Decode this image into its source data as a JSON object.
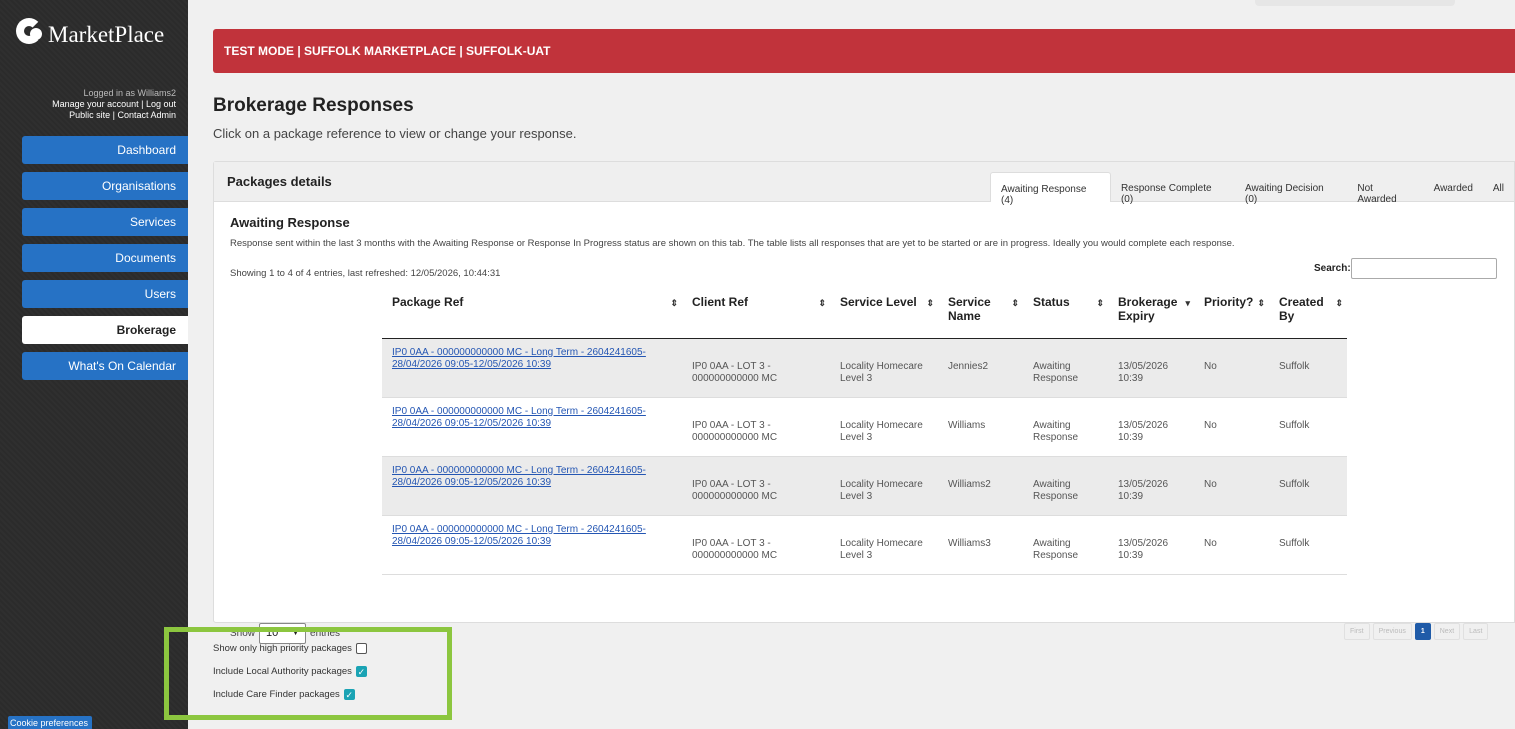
{
  "app": {
    "name": "MarketPlace"
  },
  "account": {
    "logged_in": "Logged in as Williams2",
    "links_line1": "Manage your account | Log out",
    "links_line2": "Public site | Contact Admin"
  },
  "nav": [
    {
      "label": "Dashboard",
      "active": false
    },
    {
      "label": "Organisations",
      "active": false
    },
    {
      "label": "Services",
      "active": false
    },
    {
      "label": "Documents",
      "active": false
    },
    {
      "label": "Users",
      "active": false
    },
    {
      "label": "Brokerage",
      "active": true
    },
    {
      "label": "What's On Calendar",
      "active": false
    }
  ],
  "cookie_label": "Cookie preferences",
  "banner": "TEST MODE | SUFFOLK MARKETPLACE | SUFFOLK-UAT",
  "page": {
    "title": "Brokerage Responses",
    "subtitle": "Click on a package reference to view or change your response."
  },
  "panel": {
    "title": "Packages details",
    "tabs": [
      "Awaiting Response (4)",
      "Response Complete (0)",
      "Awaiting Decision (0)",
      "Not Awarded",
      "Awarded",
      "All"
    ],
    "section_title": "Awaiting Response",
    "section_desc": "Response sent within the last 3 months with the Awaiting Response or Response In Progress status are shown on this tab. The table lists all responses that are yet to be started or are in progress. Ideally you would complete each response.",
    "showing": "Showing 1 to 4 of 4 entries, last refreshed: 12/05/2026, 10:44:31",
    "search_label": "Search:",
    "search_value": ""
  },
  "table": {
    "columns": [
      "Package Ref",
      "Client Ref",
      "Service Level",
      "Service Name",
      "Status",
      "Brokerage Expiry",
      "Priority?",
      "Created By"
    ],
    "rows": [
      {
        "ref1": "IP0 0AA - 000000000000 MC - Long Term - 2604241605-",
        "ref2": "28/04/2026 09:05-12/05/2026 10:39",
        "client1": "IP0 0AA - LOT 3 -",
        "client2": "000000000000 MC",
        "level1": "Locality Homecare",
        "level2": "Level 3",
        "name": "Jennies2",
        "status1": "Awaiting",
        "status2": "Response",
        "expiry1": "13/05/2026",
        "expiry2": "10:39",
        "priority": "No",
        "created": "Suffolk"
      },
      {
        "ref1": "IP0 0AA - 000000000000 MC - Long Term - 2604241605-",
        "ref2": "28/04/2026 09:05-12/05/2026 10:39",
        "client1": "IP0 0AA - LOT 3 -",
        "client2": "000000000000 MC",
        "level1": "Locality Homecare",
        "level2": "Level 3",
        "name": "Williams",
        "status1": "Awaiting",
        "status2": "Response",
        "expiry1": "13/05/2026",
        "expiry2": "10:39",
        "priority": "No",
        "created": "Suffolk"
      },
      {
        "ref1": "IP0 0AA - 000000000000 MC - Long Term - 2604241605-",
        "ref2": "28/04/2026 09:05-12/05/2026 10:39",
        "client1": "IP0 0AA - LOT 3 -",
        "client2": "000000000000 MC",
        "level1": "Locality Homecare",
        "level2": "Level 3",
        "name": "Williams2",
        "status1": "Awaiting",
        "status2": "Response",
        "expiry1": "13/05/2026",
        "expiry2": "10:39",
        "priority": "No",
        "created": "Suffolk"
      },
      {
        "ref1": "IP0 0AA - 000000000000 MC - Long Term - 2604241605-",
        "ref2": "28/04/2026 09:05-12/05/2026 10:39",
        "client1": "IP0 0AA - LOT 3 -",
        "client2": "000000000000 MC",
        "level1": "Locality Homecare",
        "level2": "Level 3",
        "name": "Williams3",
        "status1": "Awaiting",
        "status2": "Response",
        "expiry1": "13/05/2026",
        "expiry2": "10:39",
        "priority": "No",
        "created": "Suffolk"
      }
    ]
  },
  "length": {
    "show": "Show",
    "value": "10",
    "entries": "entries"
  },
  "pager": {
    "first": "First",
    "previous": "Previous",
    "current": "1",
    "next": "Next",
    "last": "Last"
  },
  "filters": [
    {
      "label": "Show only high priority packages",
      "checked": false
    },
    {
      "label": "Include Local Authority packages",
      "checked": true
    },
    {
      "label": "Include Care Finder packages",
      "checked": true
    }
  ],
  "colors": {
    "sidebar_bg": "#2b2b2b",
    "nav_blue": "#2672c5",
    "banner_red": "#c1333b",
    "highlight_green": "#8cc63f",
    "checkbox_teal": "#1aa3b4",
    "link_blue": "#2456b3"
  }
}
